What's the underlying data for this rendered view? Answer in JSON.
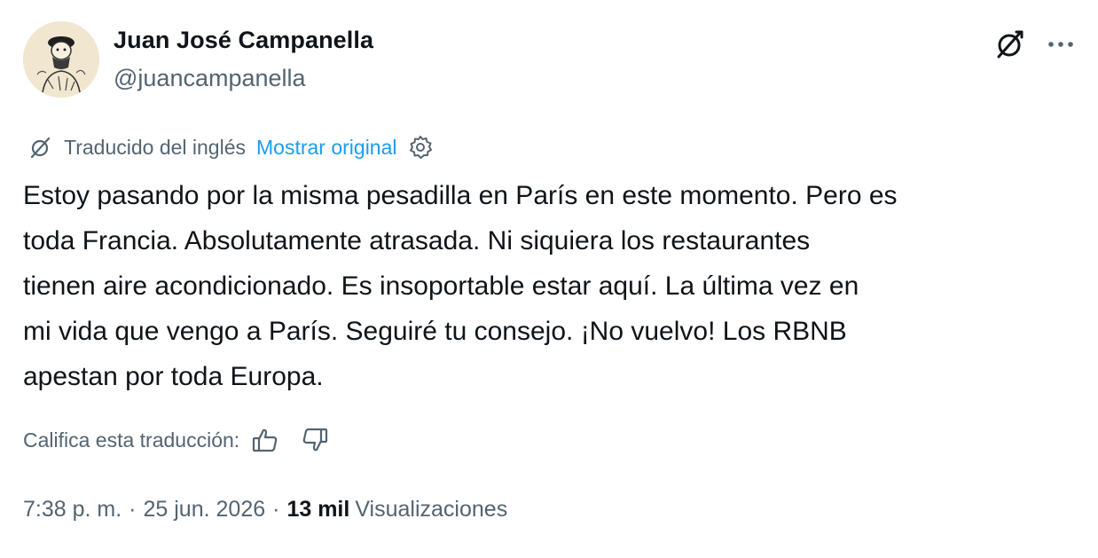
{
  "author": {
    "name": "Juan José Campanella",
    "handle": "@juancampanella",
    "avatar_icon": "caricature-avatar"
  },
  "header_actions": {
    "translate_icon": "translate-icon",
    "more_icon": "more-dots-icon"
  },
  "translation": {
    "label": "Traducido del inglés",
    "show_original": "Mostrar original",
    "settings_icon": "gear-icon"
  },
  "tweet": {
    "text": "Estoy pasando por la misma pesadilla en París en este momento. Pero es\ntoda Francia. Absolutamente atrasada. Ni siquiera los restaurantes\ntienen aire acondicionado. Es insoportable estar aquí. La última vez en\nmi vida que vengo a París. Seguiré tu consejo. ¡No vuelvo! Los RBNB\napestan por toda Europa."
  },
  "rating": {
    "label": "Califica esta traducción:",
    "thumbs_up_icon": "thumbs-up-icon",
    "thumbs_down_icon": "thumbs-down-icon"
  },
  "meta": {
    "time": "7:38 p. m.",
    "separator": "·",
    "date": "25 jun. 2026",
    "views_count": "13 mil",
    "views_label": "Visualizaciones"
  },
  "colors": {
    "text": "#0f1419",
    "secondary": "#536471",
    "link": "#1d9bf0"
  }
}
